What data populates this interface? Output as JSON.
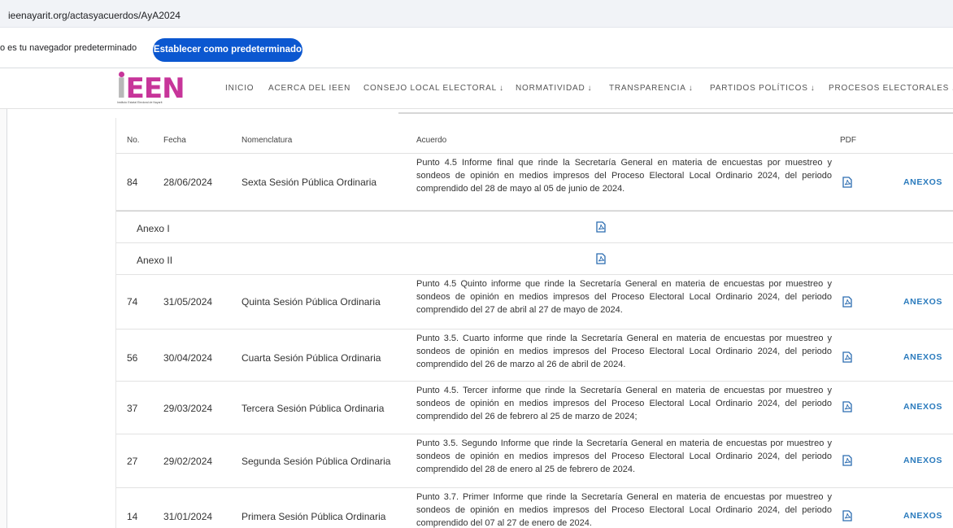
{
  "browser": {
    "url": "ieenayarit.org/actasyacuerdos/AyA2024",
    "infobar_text": "o es tu navegador predeterminado",
    "set_default_label": "Establecer como predeterminado"
  },
  "site": {
    "logo_text": "IEEN",
    "logo_subtitle": "Instituto Estatal Electoral de Nayarit",
    "brand_color": "#c7359a",
    "nav": [
      {
        "label": "INICIO",
        "dropdown": false
      },
      {
        "label": "ACERCA DEL IEEN",
        "dropdown": false
      },
      {
        "label": "CONSEJO LOCAL ELECTORAL",
        "dropdown": true
      },
      {
        "label": "NORMATIVIDAD",
        "dropdown": true
      },
      {
        "label": "TRANSPARENCIA",
        "dropdown": true
      },
      {
        "label": "PARTIDOS POLÍTICOS",
        "dropdown": true
      },
      {
        "label": "PROCESOS ELECTORALES",
        "dropdown": true
      }
    ],
    "dropdown_arrow": "↓"
  },
  "table": {
    "headers": {
      "no": "No.",
      "fecha": "Fecha",
      "nomenclatura": "Nomenclatura",
      "acuerdo": "Acuerdo",
      "pdf": "PDF"
    },
    "anexos_label": "ANEXOS",
    "rows": [
      {
        "no": "84",
        "fecha": "28/06/2024",
        "nomenclatura": "Sexta Sesión Pública Ordinaria",
        "acuerdo": "Punto 4.5 Informe final que rinde la Secretaría General en materia de encuestas por muestreo y sondeos de opinión en medios impresos del Proceso Electoral Local Ordinario 2024, del periodo comprendido del 28 de mayo al 05 de junio de 2024."
      },
      {
        "no": "74",
        "fecha": "31/05/2024",
        "nomenclatura": "Quinta Sesión Pública Ordinaria",
        "acuerdo": "Punto 4.5 Quinto informe que rinde la Secretaría General en materia de encuestas por muestreo y sondeos de opinión en medios impresos del Proceso Electoral Local Ordinario 2024, del periodo comprendido del 27 de abril al 27 de mayo de 2024."
      },
      {
        "no": "56",
        "fecha": "30/04/2024",
        "nomenclatura": "Cuarta Sesión Pública Ordinaria",
        "acuerdo": "Punto 3.5. Cuarto informe que rinde la Secretaría General en materia de encuestas por muestreo y sondeos de opinión en medios impresos del Proceso Electoral Local Ordinario 2024, del periodo comprendido del 26 de marzo al 26 de abril de 2024."
      },
      {
        "no": "37",
        "fecha": "29/03/2024",
        "nomenclatura": "Tercera Sesión Pública Ordinaria",
        "acuerdo": "Punto 4.5. Tercer informe que rinde la Secretaría General en materia de encuestas por muestreo y sondeos de opinión en medios impresos del Proceso Electoral Local Ordinario 2024, del periodo comprendido del 26 de febrero al 25 de marzo de 2024;"
      },
      {
        "no": "27",
        "fecha": "29/02/2024",
        "nomenclatura": "Segunda Sesión Pública Ordinaria",
        "acuerdo": "Punto 3.5. Segundo Informe que rinde la Secretaría General en materia de encuestas por muestreo y sondeos de opinión en medios impresos del Proceso Electoral Local Ordinario 2024, del periodo comprendido del 28 de enero al 25 de febrero de 2024."
      },
      {
        "no": "14",
        "fecha": "31/01/2024",
        "nomenclatura": "Primera Sesión Pública Ordinaria",
        "acuerdo": "Punto 3.7. Primer Informe que rinde la Secretaría General en materia de encuestas por muestreo y sondeos de opinión en medios impresos del Proceso Electoral Local Ordinario 2024, del periodo comprendido del 07 al 27 de enero de 2024."
      }
    ],
    "annexes": [
      {
        "label": "Anexo I"
      },
      {
        "label": "Anexo II"
      }
    ]
  }
}
